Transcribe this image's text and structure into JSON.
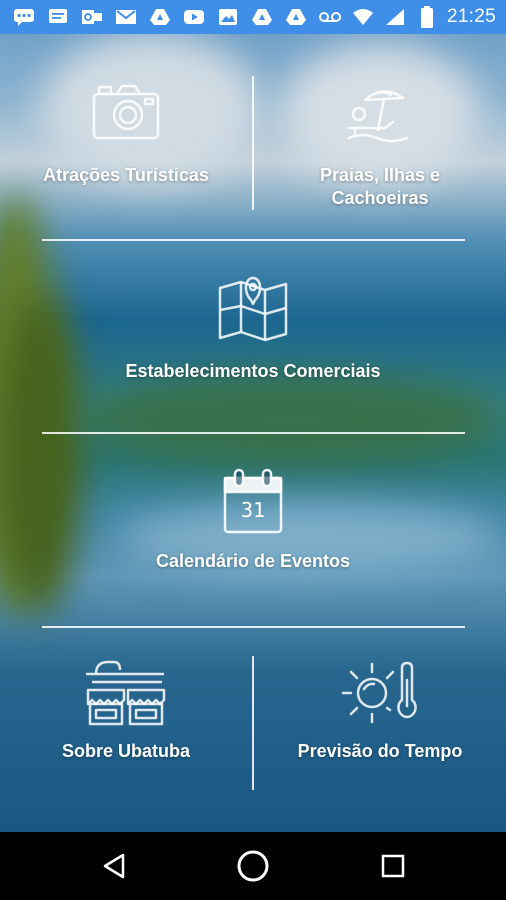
{
  "status_bar": {
    "time": "21:25",
    "notification_icons": [
      "chat-icon",
      "message-icon",
      "outlook-icon",
      "gmail-icon",
      "drive-icon",
      "youtube-icon",
      "gallery-icon",
      "drive-icon",
      "drive-icon",
      "voicemail-icon"
    ],
    "system_icons": [
      "wifi-icon",
      "signal-icon",
      "battery-icon"
    ]
  },
  "menu": {
    "attractions": "Atrações Turísticas",
    "beaches_line1": "Praias, Ilhas e",
    "beaches_line2": "Cachoeiras",
    "commerce": "Estabelecimentos Comerciais",
    "calendar": "Calendário de Eventos",
    "calendar_day": "31",
    "about": "Sobre Ubatuba",
    "weather": "Previsão do Tempo"
  },
  "nav_bar": {
    "buttons": [
      "back-icon",
      "home-icon",
      "recents-icon"
    ]
  },
  "colors": {
    "status_bar": "#3f8ee8",
    "text": "#ffffff",
    "nav_bar": "#000000"
  }
}
